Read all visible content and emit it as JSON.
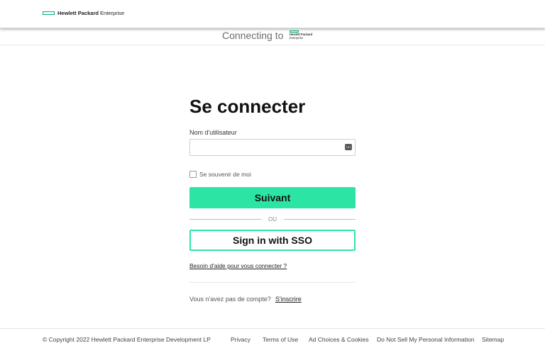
{
  "header": {
    "brand_bold": "Hewlett Packard",
    "brand_light": "Enterprise"
  },
  "connecting": {
    "label": "Connecting to",
    "logo_line1": "Hewlett Packard",
    "logo_line2": "Enterprise"
  },
  "login": {
    "title": "Se connecter",
    "username_label": "Nom d'utilisateur",
    "username_value": "",
    "remember_label": "Se souvenir de moi",
    "next_button": "Suivant",
    "or_text": "OU",
    "sso_button": "Sign in with SSO",
    "help_link": "Besoin d'aide pour vous connecter ?",
    "no_account_text": "Vous n'avez pas de compte?",
    "signup_link": "S'inscrire"
  },
  "footer": {
    "copyright": "© Copyright 2022 Hewlett Packard Enterprise Development LP",
    "links": [
      "Privacy",
      "Terms of Use",
      "Ad Choices & Cookies",
      "Do Not Sell My Personal Information",
      "Sitemap"
    ]
  },
  "colors": {
    "accent": "#01a982",
    "button_primary": "#2ce5a4"
  },
  "icons": [
    "hpe-logo-icon",
    "password-manager-icon",
    "checkbox-icon"
  ]
}
